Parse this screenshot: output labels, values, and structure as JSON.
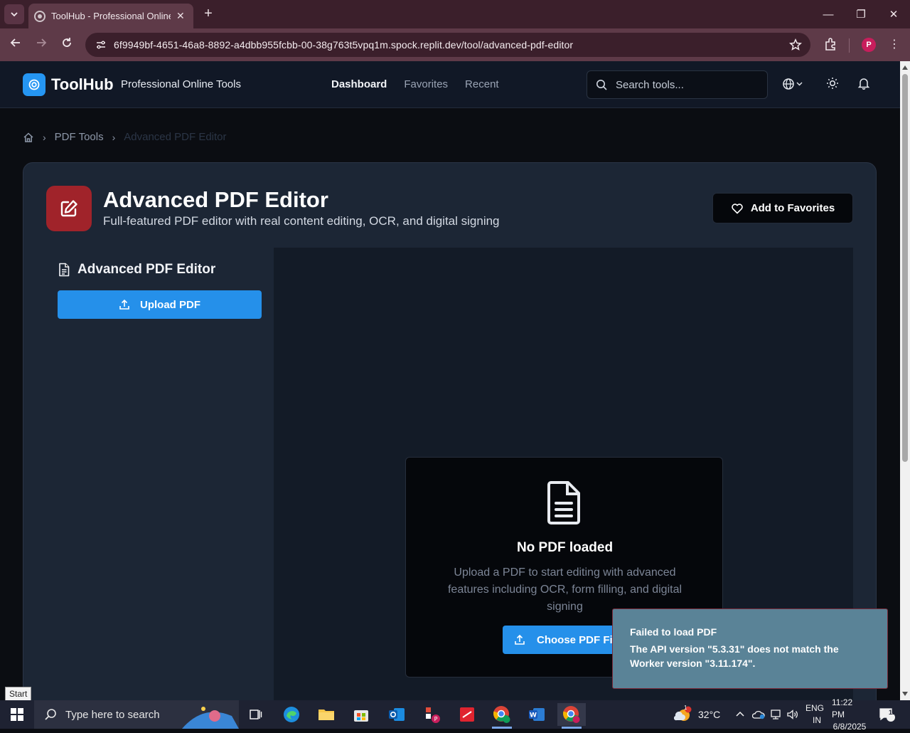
{
  "browser": {
    "tab_title": "ToolHub - Professional Online Tools",
    "url": "6f9949bf-4651-46a8-8892-a4dbb955fcbb-00-38g763t5vpq1m.spock.replit.dev/tool/advanced-pdf-editor",
    "profile_initial": "P"
  },
  "header": {
    "brand": "ToolHub",
    "tagline": "Professional Online Tools",
    "nav": [
      "Dashboard",
      "Favorites",
      "Recent"
    ],
    "search_placeholder": "Search tools..."
  },
  "breadcrumb": {
    "section": "PDF Tools",
    "current": "Advanced PDF Editor"
  },
  "tool": {
    "title": "Advanced PDF Editor",
    "description": "Full-featured PDF editor with real content editing, OCR, and digital signing",
    "favorite_label": "Add to Favorites"
  },
  "sidebar": {
    "title": "Advanced PDF Editor",
    "upload_label": "Upload PDF"
  },
  "empty_state": {
    "title": "No PDF loaded",
    "description": "Upload a PDF to start editing with advanced features including OCR, form filling, and digital signing",
    "button_label": "Choose PDF File"
  },
  "toast": {
    "title": "Failed to load PDF",
    "message": "The API version \"5.3.31\" does not match the Worker version \"3.11.174\"."
  },
  "taskbar": {
    "start_tooltip": "Start",
    "search_placeholder": "Type here to search",
    "weather": "32°C",
    "lang_top": "ENG",
    "lang_bottom": "IN",
    "time": "11:22 PM",
    "date": "6/8/2025",
    "notification_count": "12",
    "weather_badge": "1"
  },
  "colors": {
    "accent": "#2590ea",
    "tool_icon_bg": "#a0232a",
    "toast_bg": "#5a8397"
  }
}
